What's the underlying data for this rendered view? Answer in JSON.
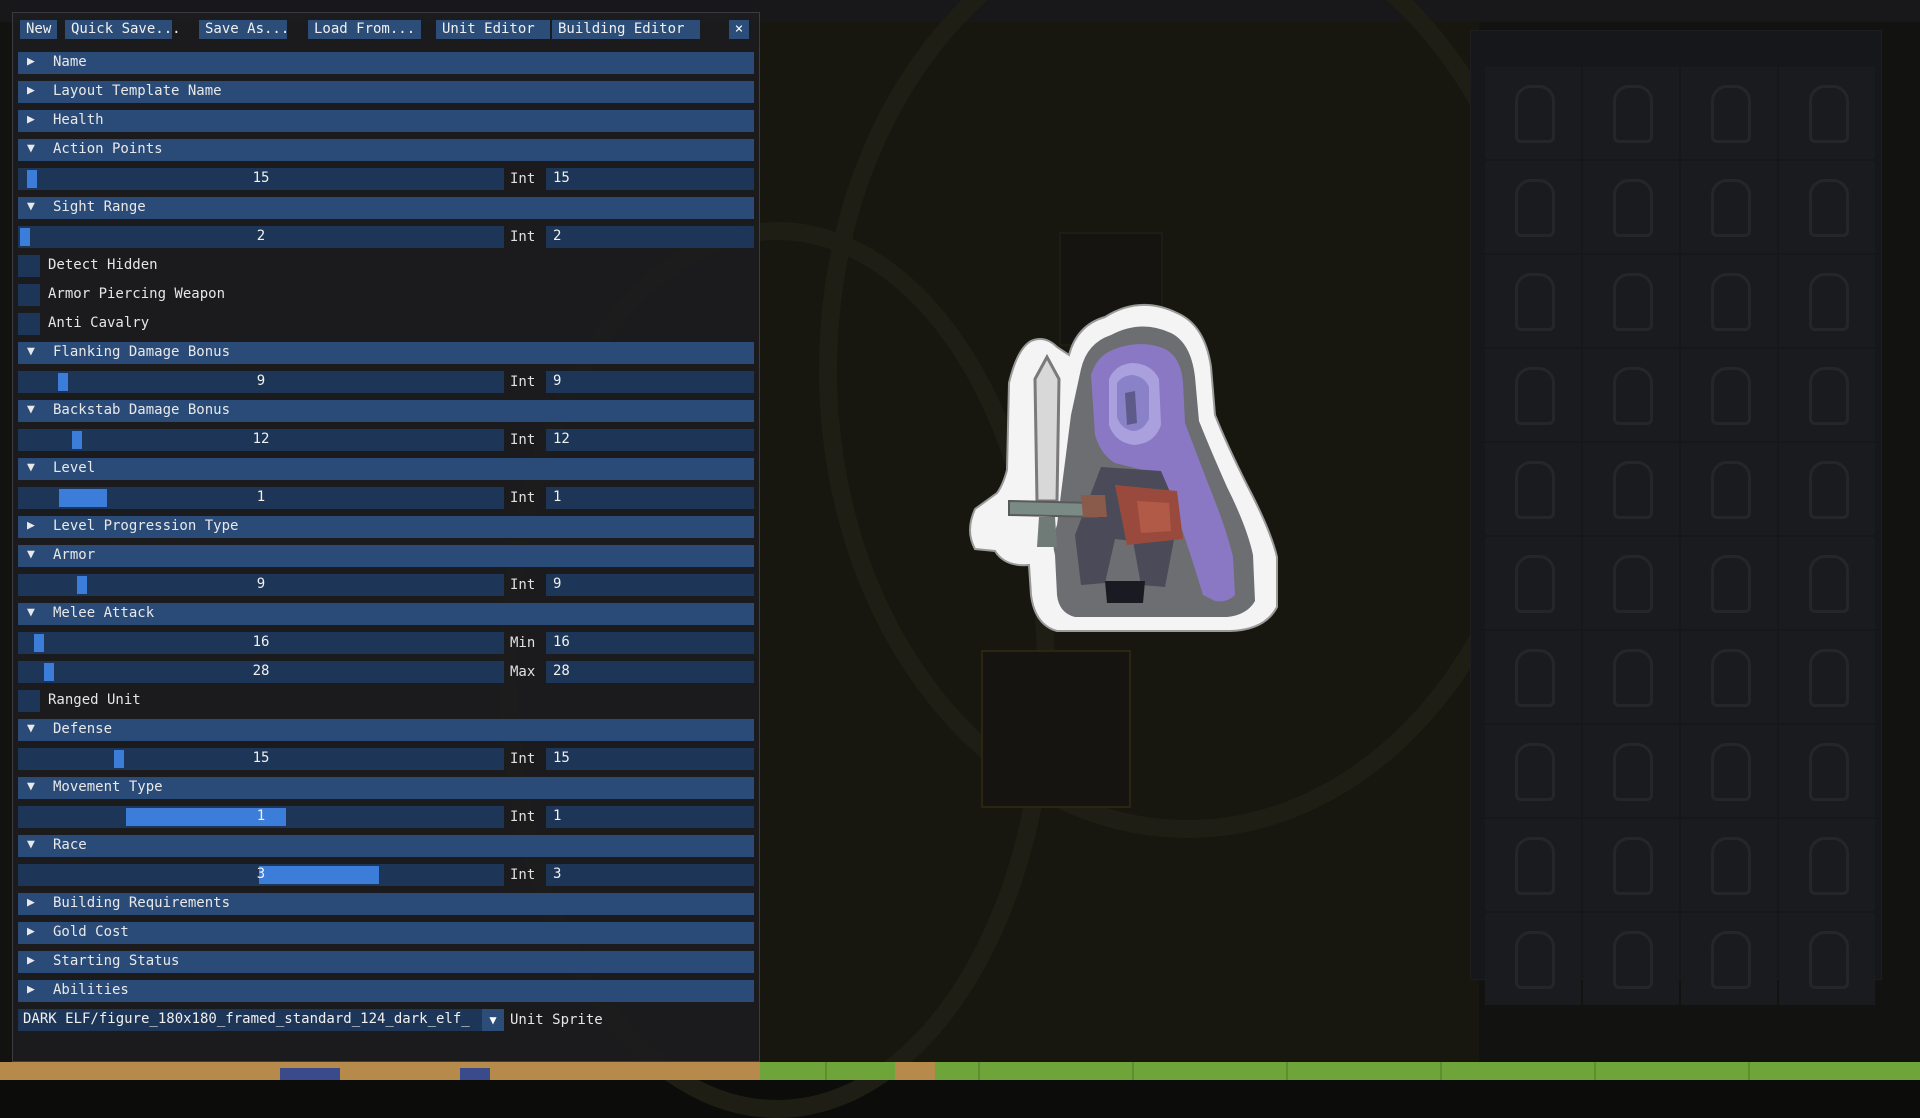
{
  "toolbar": {
    "new": "New",
    "quick_save": "Quick Save...",
    "save_as": "Save As...",
    "load_from": "Load From...",
    "unit_editor": "Unit Editor",
    "building_editor": "Building Editor",
    "close": "×"
  },
  "sections": {
    "name": "Name",
    "layout_template_name": "Layout Template Name",
    "health": "Health",
    "action_points": "Action Points",
    "sight_range": "Sight Range",
    "flanking_damage_bonus": "Flanking Damage Bonus",
    "backstab_damage_bonus": "Backstab Damage Bonus",
    "level": "Level",
    "level_progression_type": "Level Progression Type",
    "armor": "Armor",
    "melee_attack": "Melee Attack",
    "defense": "Defense",
    "movement_type": "Movement Type",
    "race": "Race",
    "building_requirements": "Building Requirements",
    "gold_cost": "Gold Cost",
    "starting_status": "Starting Status",
    "abilities": "Abilities"
  },
  "fields": {
    "action_points": {
      "value": "15",
      "label": "Int",
      "input": "15",
      "fill": 0.015
    },
    "sight_range": {
      "value": "2",
      "label": "Int",
      "input": "2",
      "fill": 0.0
    },
    "flanking_damage_bonus": {
      "value": "9",
      "label": "Int",
      "input": "9",
      "fill": 0.08
    },
    "backstab_damage_bonus": {
      "value": "12",
      "label": "Int",
      "input": "12",
      "fill": 0.11
    },
    "level": {
      "value": "1",
      "label": "Int",
      "input": "1",
      "fill": 0.09
    },
    "armor": {
      "value": "9",
      "label": "Int",
      "input": "9",
      "fill": 0.12
    },
    "melee_min": {
      "value": "16",
      "label": "Min",
      "input": "16",
      "fill": 0.03
    },
    "melee_max": {
      "value": "28",
      "label": "Max",
      "input": "28",
      "fill": 0.05
    },
    "defense": {
      "value": "15",
      "label": "Int",
      "input": "15",
      "fill": 0.2
    },
    "movement_type": {
      "value": "1",
      "label": "Int",
      "input": "1",
      "fill": 0.33
    },
    "race": {
      "value": "3",
      "label": "Int",
      "input": "3",
      "fill": 0.66
    }
  },
  "checkboxes": {
    "detect_hidden": "Detect Hidden",
    "armor_piercing_weapon": "Armor Piercing Weapon",
    "anti_cavalry": "Anti Cavalry",
    "ranged_unit": "Ranged Unit"
  },
  "unit_sprite": {
    "value": "DARK ELF/figure_180x180_framed_standard_124_dark_elf_",
    "label": "Unit Sprite"
  },
  "colors": {
    "header": "#2a4b77",
    "field": "#1d3556",
    "accent": "#3b7dd8"
  },
  "sprite_icon": "hooded-dark-elf-swordsman"
}
